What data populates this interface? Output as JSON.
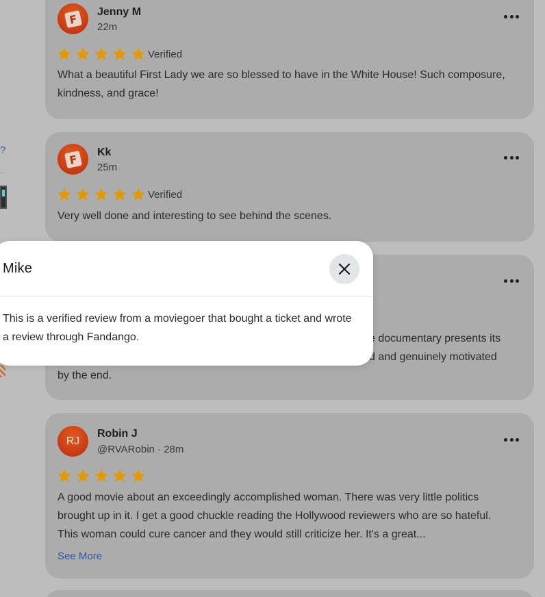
{
  "left_rail": {
    "question_mark": "?"
  },
  "reviews": [
    {
      "name": "Jenny M",
      "time": "22m",
      "rating": 5,
      "verified_label": "Verified",
      "text": "What a beautiful First Lady we are so blessed to have in the White House! Such composure, kindness, and grace!"
    },
    {
      "name": "Kk",
      "time": "25m",
      "rating": 5,
      "verified_label": "Verified",
      "text": "Very well done and interesting to see behind the scenes."
    },
    {
      "partial_text_line1": "e documentary presents its",
      "partial_text_line2": "d and genuinely motivated",
      "partial_text_line3": "by the end."
    },
    {
      "name": "Robin J",
      "avatar_initials": "RJ",
      "handle_time": "@RVARobin · 28m",
      "rating": 5,
      "text": "A good movie about an exceedingly accomplished woman. There was very little politics brought up in it. I get a good chuckle reading the Hollywood reviewers who are so hateful. This woman could cure cancer and they would still criticize her. It's a great...",
      "see_more": "See More"
    }
  ],
  "popup": {
    "title": "Mike",
    "text": "This is a verified review from a moviegoer that bought a ticket and wrote a review through Fandango."
  },
  "colors": {
    "star": "#e19a06",
    "link": "#2f57a6",
    "avatar": "#c9371a"
  }
}
